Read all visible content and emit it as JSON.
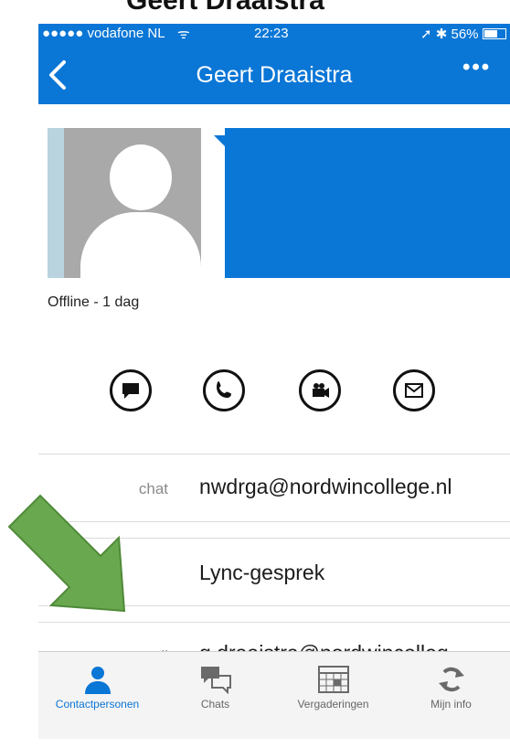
{
  "frame": {
    "top_text": "Geert Draaistra"
  },
  "status_bar": {
    "signal": "●●●●● vodafone NL",
    "wifi": "ᯤ",
    "time": "22:23",
    "battery": "➚ ✱ 56%"
  },
  "header": {
    "back_icon": "chevron-left-icon",
    "title": "Geert Draaistra",
    "more": "•••"
  },
  "profile": {
    "presence": "Offline - 1 dag"
  },
  "actions": [
    {
      "name": "chat-action-button",
      "icon": "chat-bubble-icon"
    },
    {
      "name": "call-action-button",
      "icon": "phone-icon"
    },
    {
      "name": "video-action-button",
      "icon": "video-camera-icon"
    },
    {
      "name": "email-action-button",
      "icon": "envelope-icon"
    }
  ],
  "details": [
    {
      "label": "chat",
      "value": "nwdrga@nordwincollege.nl"
    },
    {
      "label": "",
      "value": "Lync-gesprek"
    },
    {
      "label": "e-mail",
      "value": "g.draaistra@nordwincolleg…"
    }
  ],
  "tabs": [
    {
      "label": "Contactpersonen",
      "icon": "person-icon",
      "active": true
    },
    {
      "label": "Chats",
      "icon": "chats-icon",
      "active": false
    },
    {
      "label": "Vergaderingen",
      "icon": "calendar-icon",
      "active": false
    },
    {
      "label": "Mijn info",
      "icon": "sync-icon",
      "active": false
    }
  ],
  "colors": {
    "accent": "#0a76d6",
    "arrow": "#6aa84f"
  }
}
